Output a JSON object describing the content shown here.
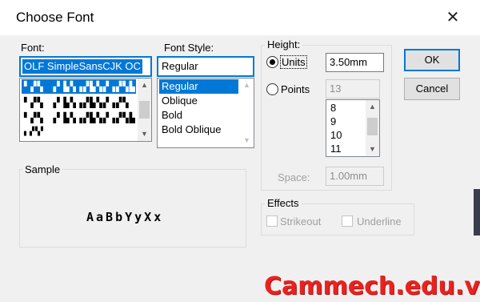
{
  "window": {
    "title": "Choose Font",
    "close_glyph": "✕"
  },
  "font": {
    "label": "Font:",
    "value": "OLF SimpleSansCJK OC",
    "items": [
      "▘▞▚ ▗▘▙▚▗▞▙▚▞▗▞▚▙",
      "▘▞▚ ▗▘▙▚▗▞▙▚▞▗▞▚",
      "▘▞▚ ▗▘▙▚▗▞▙▚▞▗▞▚▙",
      "▖▞▚▘"
    ],
    "selected_index": 0
  },
  "font_style": {
    "label": "Font Style:",
    "value": "Regular",
    "items": [
      "Regular",
      "Oblique",
      "Bold",
      "Bold Oblique"
    ],
    "selected_index": 0
  },
  "height": {
    "group_label": "Height:",
    "units_label": "Units",
    "units_value": "3.50mm",
    "units_checked": true,
    "points_label": "Points",
    "points_value": "13",
    "points_checked": false,
    "points_list": [
      "8",
      "9",
      "10",
      "11"
    ],
    "space_label": "Space:",
    "space_value": "1.00mm"
  },
  "sample": {
    "label": "Sample",
    "text": "AaBbYyXx"
  },
  "effects": {
    "label": "Effects",
    "strikeout_label": "Strikeout",
    "underline_label": "Underline",
    "strikeout_checked": false,
    "underline_checked": false
  },
  "buttons": {
    "ok": "OK",
    "cancel": "Cancel"
  },
  "watermark": "Cammech.edu.vn",
  "colors": {
    "accent": "#0078d7",
    "watermark": "#e8231f"
  }
}
